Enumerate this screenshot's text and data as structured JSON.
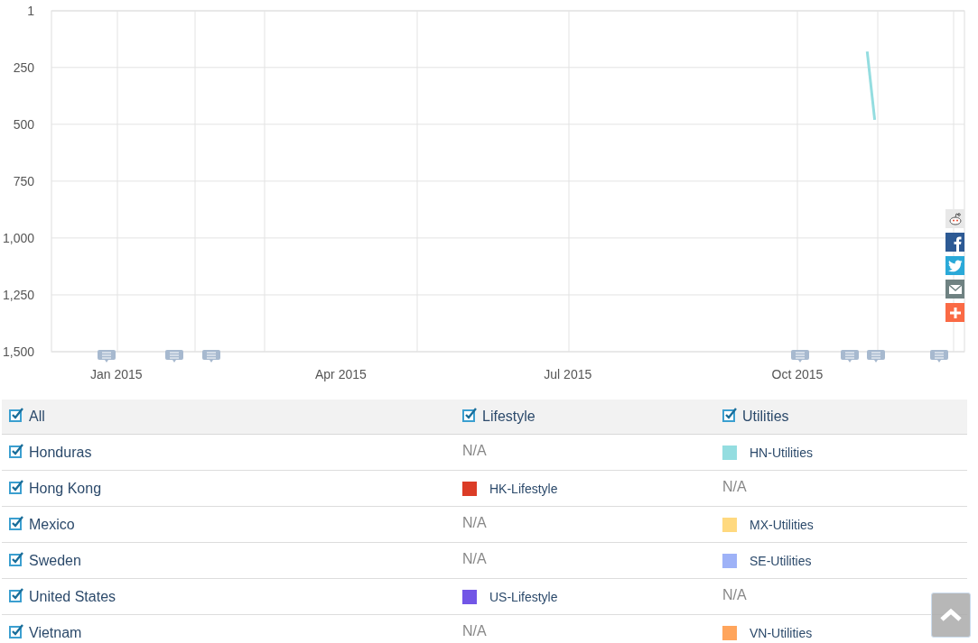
{
  "chart": {
    "chart_data": {
      "type": "line",
      "x": [
        "2015-10-29",
        "2015-11-01"
      ],
      "series": [
        {
          "color": "#94dde0",
          "values": [
            180,
            480
          ]
        }
      ],
      "xlim": [
        "2014-12-06",
        "2015-12-07"
      ],
      "ylim": [
        1500,
        1
      ],
      "xticks": [
        {
          "value": "2015-01-01",
          "label": "Jan 2015"
        },
        {
          "value": "2015-04-01",
          "label": "Apr 2015"
        },
        {
          "value": "2015-07-01",
          "label": "Jul 2015"
        },
        {
          "value": "2015-10-01",
          "label": "Oct 2015"
        }
      ],
      "yticks": [
        {
          "value": 1,
          "label": "1"
        },
        {
          "value": 250,
          "label": "250"
        },
        {
          "value": 500,
          "label": "500"
        },
        {
          "value": 750,
          "label": "750"
        },
        {
          "value": 1000,
          "label": "1,000"
        },
        {
          "value": 1250,
          "label": "1,250"
        },
        {
          "value": 1500,
          "label": "1,500"
        }
      ],
      "grid": true
    }
  },
  "table": {
    "header": [
      {
        "label": "All",
        "checked": true
      },
      {
        "label": "Lifestyle",
        "checked": true
      },
      {
        "label": "Utilities",
        "checked": true
      }
    ],
    "rows": [
      {
        "country": "Honduras",
        "checked": true,
        "cells": [
          {
            "kind": "na",
            "text": "N/A"
          },
          {
            "kind": "series",
            "label": "HN-Utilities",
            "color": "#94dde0"
          }
        ]
      },
      {
        "country": "Hong Kong",
        "checked": true,
        "cells": [
          {
            "kind": "series",
            "label": "HK-Lifestyle",
            "color": "#db3c26"
          },
          {
            "kind": "na",
            "text": "N/A"
          }
        ]
      },
      {
        "country": "Mexico",
        "checked": true,
        "cells": [
          {
            "kind": "na",
            "text": "N/A"
          },
          {
            "kind": "series",
            "label": "MX-Utilities",
            "color": "#ffd97f"
          }
        ]
      },
      {
        "country": "Sweden",
        "checked": true,
        "cells": [
          {
            "kind": "na",
            "text": "N/A"
          },
          {
            "kind": "series",
            "label": "SE-Utilities",
            "color": "#9eb2f7"
          }
        ]
      },
      {
        "country": "United States",
        "checked": true,
        "cells": [
          {
            "kind": "series",
            "label": "US-Lifestyle",
            "color": "#7256e6"
          },
          {
            "kind": "na",
            "text": "N/A"
          }
        ]
      },
      {
        "country": "Vietnam",
        "checked": true,
        "cells": [
          {
            "kind": "na",
            "text": "N/A"
          },
          {
            "kind": "series",
            "label": "VN-Utilities",
            "color": "#ffa55c"
          }
        ]
      }
    ]
  }
}
